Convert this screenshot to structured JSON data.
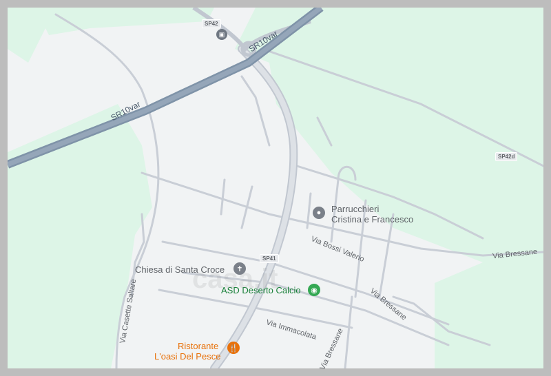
{
  "roads": {
    "sr10var_top": "SR10var",
    "sr10var_left": "SR10var",
    "sp42": "SP42",
    "sp42d": "SP42d",
    "sp41": "SP41"
  },
  "streets": {
    "via_bossi_valerio": "Via Bossi Valerio",
    "via_bressane_right": "Via Bressane",
    "via_bressane_mid": "Via Bressane",
    "via_casette_saltare": "Via Casette Saltare",
    "via_immacolata": "Via Immacolata",
    "via_bressane_bottom": "Via Bressane"
  },
  "places": {
    "parrucchieri_line1": "Parrucchieri",
    "parrucchieri_line2": "Cristina e Francesco",
    "chiesa": "Chiesa di Santa Croce",
    "asd": "ASD Deserto Calcio",
    "ristorante_line1": "Ristorante",
    "ristorante_line2": "L'oasi Del Pesce"
  },
  "icons": {
    "parrucchieri": "service-icon",
    "chiesa": "church-icon",
    "asd": "sports-icon",
    "ristorante": "restaurant-icon",
    "bus": "bus-stop-icon"
  },
  "colors": {
    "green_area": "#ddf5e7",
    "land": "#f1f3f4",
    "highway": "#8a9bb0",
    "road": "#c9ced6",
    "poi_gray": "#5f6368",
    "poi_green": "#188038",
    "poi_orange": "#e8710a"
  },
  "watermark": "casa.it"
}
